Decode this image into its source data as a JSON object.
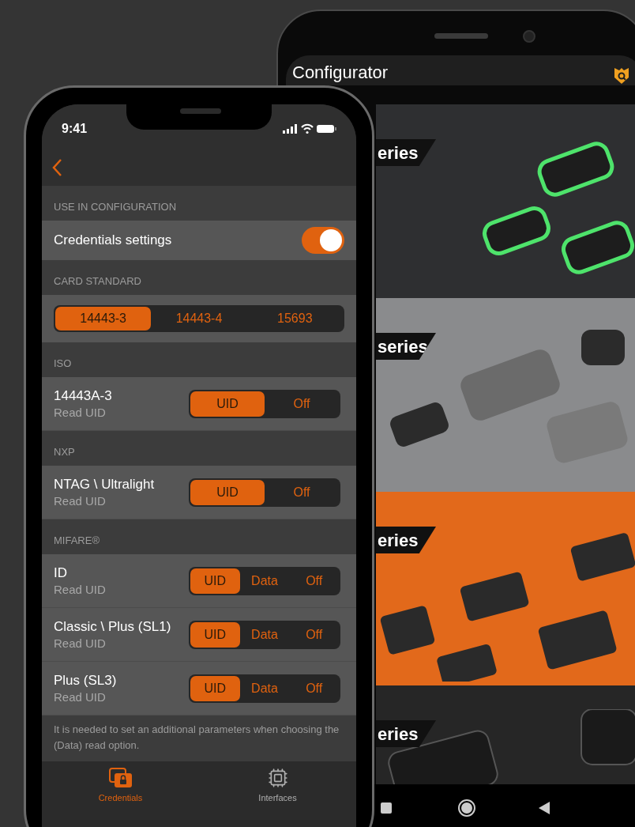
{
  "back_phone": {
    "title": "Configurator",
    "banners": [
      {
        "label": "eries",
        "color": "#2e2f31"
      },
      {
        "label": "series",
        "color": "#8a8b8d"
      },
      {
        "label": "eries",
        "color": "#e2691b"
      },
      {
        "label": "eries",
        "color": "#262626"
      }
    ]
  },
  "front_phone": {
    "status_time": "9:41",
    "sections": [
      {
        "header": "USE IN CONFIGURATION",
        "rows": [
          {
            "kind": "toggle",
            "label": "Credentials settings",
            "on": true
          }
        ]
      },
      {
        "header": "CARD STANDARD",
        "rows": [
          {
            "kind": "segmented",
            "options": [
              {
                "label": "14443-3",
                "selected": true
              },
              {
                "label": "14443-4",
                "selected": false
              },
              {
                "label": "15693",
                "selected": false
              }
            ]
          }
        ]
      },
      {
        "header": "ISO",
        "rows": [
          {
            "kind": "option",
            "title": "14443A-3",
            "subtitle": "Read UID",
            "options": [
              {
                "label": "UID",
                "selected": true
              },
              {
                "label": "Off",
                "selected": false
              }
            ]
          }
        ]
      },
      {
        "header": "NXP",
        "rows": [
          {
            "kind": "option",
            "title": "NTAG \\ Ultralight",
            "subtitle": "Read UID",
            "options": [
              {
                "label": "UID",
                "selected": true
              },
              {
                "label": "Off",
                "selected": false
              }
            ]
          }
        ]
      },
      {
        "header": "MIFARE®",
        "rows": [
          {
            "kind": "option",
            "title": "ID",
            "subtitle": "Read UID",
            "options": [
              {
                "label": "UID",
                "selected": true
              },
              {
                "label": "Data",
                "selected": false
              },
              {
                "label": "Off",
                "selected": false
              }
            ]
          },
          {
            "kind": "option",
            "title": "Classic \\ Plus (SL1)",
            "subtitle": "Read UID",
            "options": [
              {
                "label": "UID",
                "selected": true
              },
              {
                "label": "Data",
                "selected": false
              },
              {
                "label": "Off",
                "selected": false
              }
            ]
          },
          {
            "kind": "option",
            "title": "Plus (SL3)",
            "subtitle": "Read UID",
            "options": [
              {
                "label": "UID",
                "selected": true
              },
              {
                "label": "Data",
                "selected": false
              },
              {
                "label": "Off",
                "selected": false
              }
            ]
          }
        ]
      }
    ],
    "note": "It is needed to set an additional parameters when choosing the (Data) read option.",
    "tabs": [
      {
        "label": "Credentials",
        "kind": "credentials",
        "selected": true
      },
      {
        "label": "Interfaces",
        "kind": "chip",
        "selected": false
      }
    ]
  }
}
